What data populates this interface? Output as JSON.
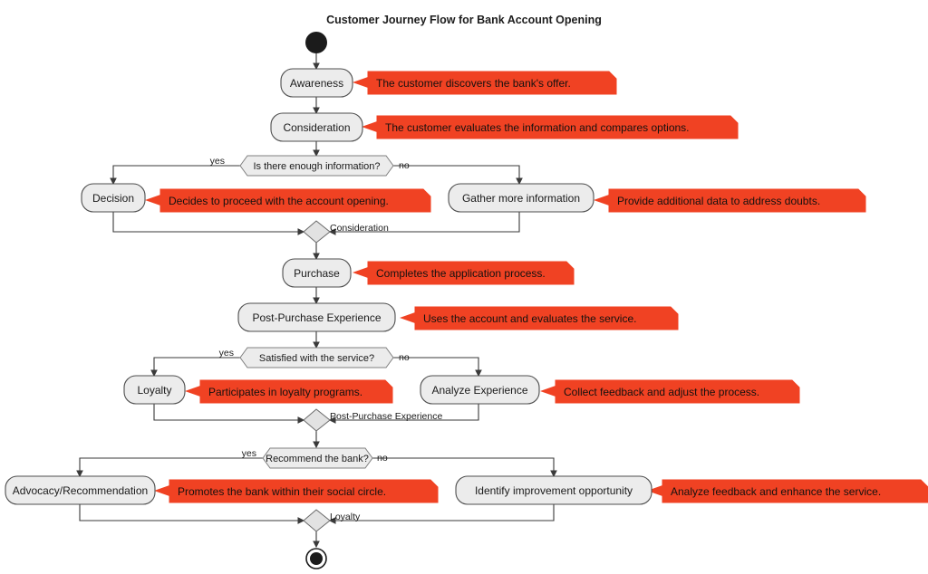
{
  "title": "Customer Journey Flow for Bank Account Opening",
  "colors": {
    "note_fill": "#F04223",
    "node_fill": "#ECECEC",
    "node_stroke": "#4E4E4E",
    "edge_stroke": "#3A3A3A",
    "background": "#FFFFFF"
  },
  "nodes": {
    "start": {
      "kind": "start-node"
    },
    "awareness": {
      "label": "Awareness"
    },
    "consideration": {
      "label": "Consideration"
    },
    "decision": {
      "label": "Decision"
    },
    "gather": {
      "label": "Gather more information"
    },
    "purchase": {
      "label": "Purchase"
    },
    "post_purchase": {
      "label": "Post-Purchase Experience"
    },
    "loyalty": {
      "label": "Loyalty"
    },
    "analyze": {
      "label": "Analyze Experience"
    },
    "advocacy": {
      "label": "Advocacy/Recommendation"
    },
    "identify": {
      "label": "Identify improvement opportunity"
    },
    "end": {
      "kind": "end-node"
    }
  },
  "decisions": [
    {
      "id": "enough-information",
      "label": "Is there enough information?",
      "yes": "yes",
      "no": "no"
    },
    {
      "id": "satisfied-service",
      "label": "Satisfied with the service?",
      "yes": "yes",
      "no": "no"
    },
    {
      "id": "recommend-bank",
      "label": "Recommend the bank?",
      "yes": "yes",
      "no": "no"
    }
  ],
  "merges": [
    {
      "id": "merge-consideration",
      "label": "Consideration"
    },
    {
      "id": "merge-post-purchase",
      "label": "Post-Purchase Experience"
    },
    {
      "id": "merge-loyalty",
      "label": "Loyalty"
    }
  ],
  "notes": [
    {
      "id": "note-awareness",
      "text": "The customer discovers the bank's offer."
    },
    {
      "id": "note-consideration",
      "text": "The customer evaluates the information and compares options."
    },
    {
      "id": "note-decision",
      "text": "Decides to proceed with the account opening."
    },
    {
      "id": "note-gather",
      "text": "Provide additional data to address doubts."
    },
    {
      "id": "note-purchase",
      "text": "Completes the application process."
    },
    {
      "id": "note-post-purchase",
      "text": "Uses the account and evaluates the service."
    },
    {
      "id": "note-loyalty",
      "text": "Participates in loyalty programs."
    },
    {
      "id": "note-analyze",
      "text": "Collect feedback and adjust the process."
    },
    {
      "id": "note-advocacy",
      "text": "Promotes the bank within their social circle."
    },
    {
      "id": "note-identify",
      "text": "Analyze feedback and enhance the service."
    }
  ]
}
